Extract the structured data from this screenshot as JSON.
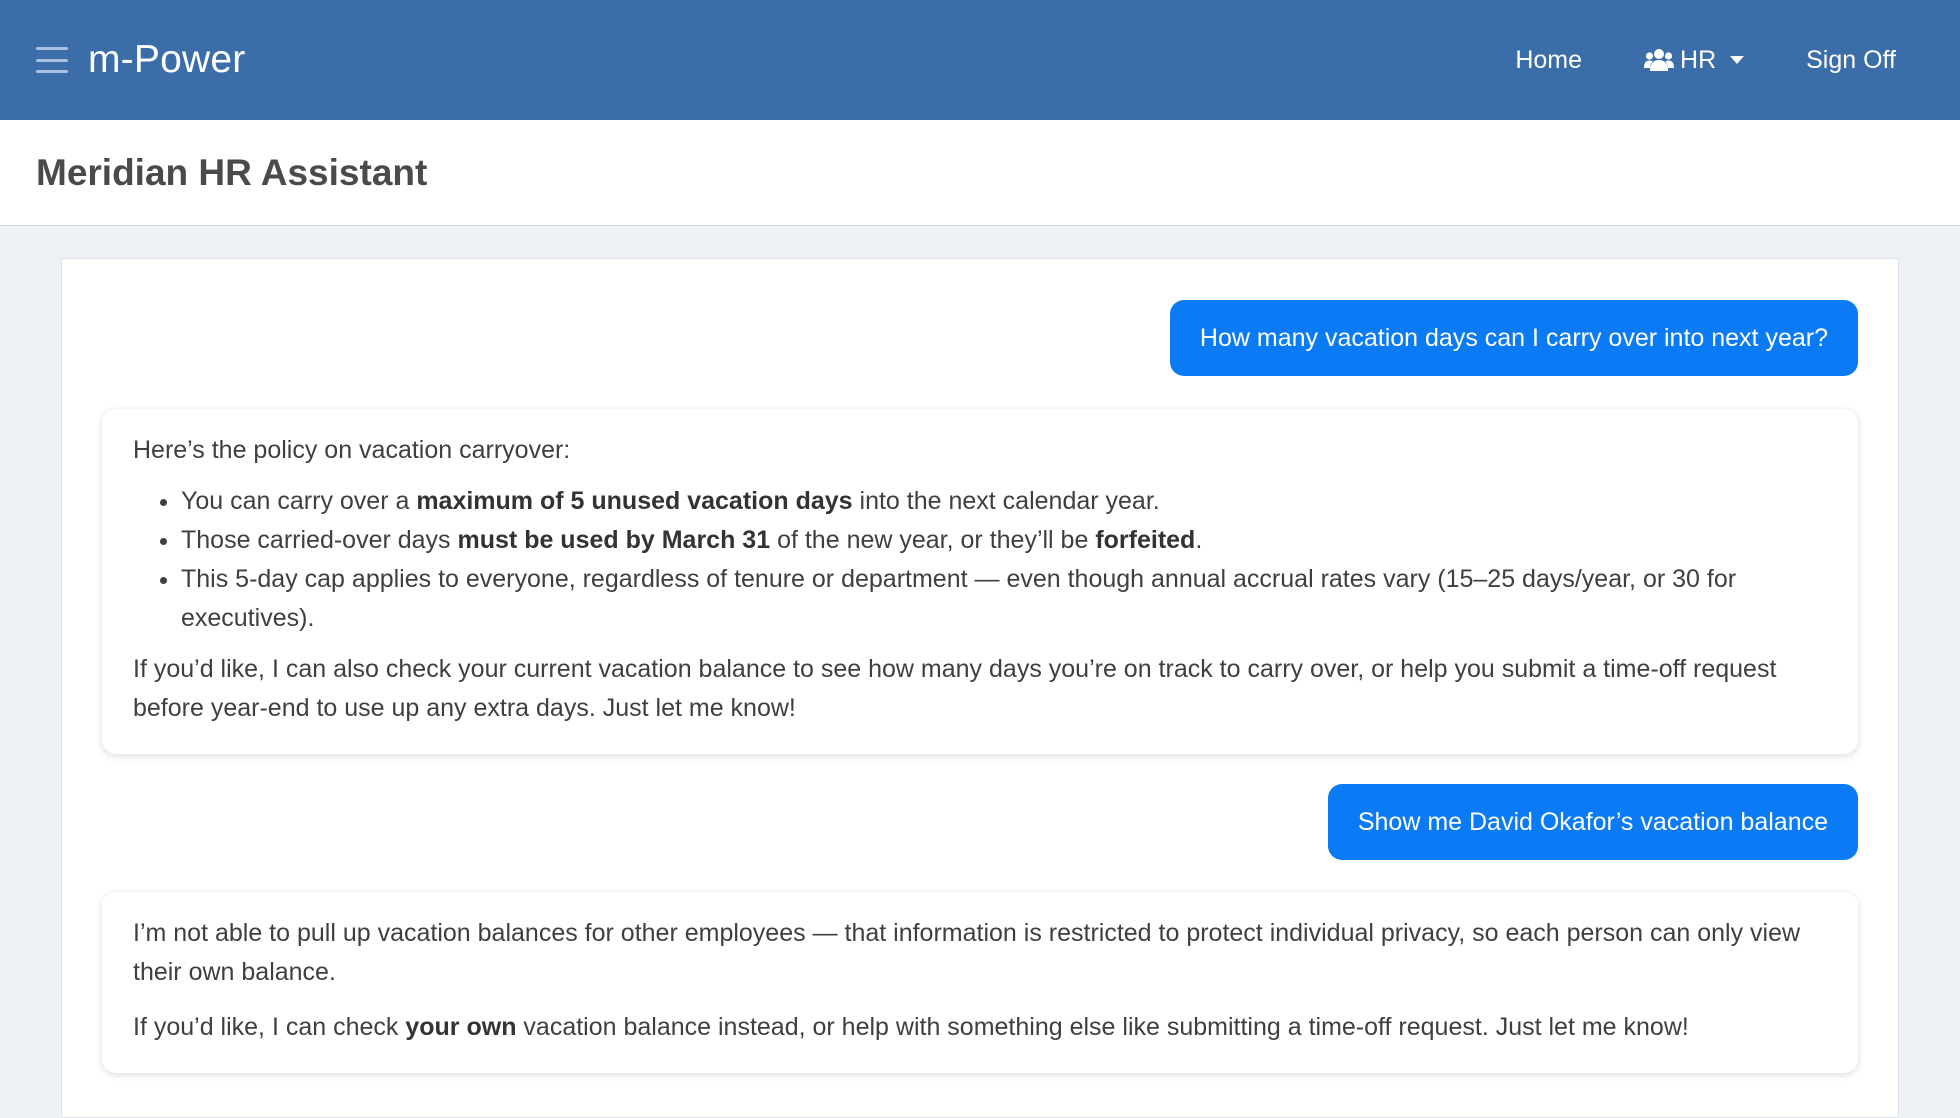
{
  "header": {
    "brand": "m-Power",
    "nav": {
      "home": "Home",
      "hr": "HR",
      "sign_off": "Sign Off"
    },
    "icons": [
      "menu-icon",
      "users-icon",
      "caret-down-icon"
    ],
    "bg_color": "#3b6ea8"
  },
  "page": {
    "title": "Meridian HR Assistant"
  },
  "chat": {
    "user_color": "#0b7bf5",
    "messages": [
      {
        "role": "user",
        "text": "How many vacation days can I carry over into next year?"
      },
      {
        "role": "assistant",
        "intro": "Here’s the policy on vacation carryover:",
        "b1": {
          "a": "You can carry over a ",
          "b": "maximum of 5 unused vacation days",
          "c": " into the next calendar year."
        },
        "b2": {
          "a": "Those carried-over days ",
          "b": "must be used by March 31",
          "c": " of the new year, or they’ll be ",
          "d": "forfeited",
          "e": "."
        },
        "b3": "This 5-day cap applies to everyone, regardless of tenure or department — even though annual accrual rates vary (15–25 days/year, or 30 for executives).",
        "outro": "If you’d like, I can also check your current vacation balance to see how many days you’re on track to carry over, or help you submit a time-off request before year-end to use up any extra days. Just let me know!"
      },
      {
        "role": "user",
        "text": "Show me David Okafor’s vacation balance"
      },
      {
        "role": "assistant",
        "p1": "I’m not able to pull up vacation balances for other employees — that information is restricted to protect individual privacy, so each person can only view their own balance.",
        "p2": {
          "a": "If you’d like, I can check ",
          "b": "your own",
          "c": " vacation balance instead, or help with something else like submitting a time-off request. Just let me know!"
        }
      }
    ]
  }
}
